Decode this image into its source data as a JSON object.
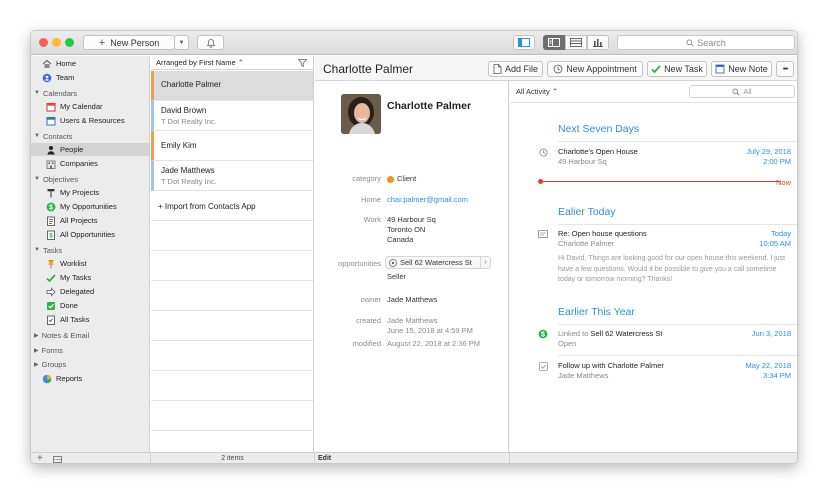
{
  "toolbar": {
    "new_person": "New Person",
    "search_placeholder": "Search"
  },
  "sidebar": {
    "home": "Home",
    "team": "Team",
    "calendars": {
      "label": "Calendars",
      "items": [
        "My Calendar",
        "Users & Resources"
      ]
    },
    "contacts": {
      "label": "Contacts",
      "items": [
        "People",
        "Companies"
      ]
    },
    "objectives": {
      "label": "Objectives",
      "items": [
        "My Projects",
        "My Opportunities",
        "All Projects",
        "All Opportunities"
      ]
    },
    "tasks": {
      "label": "Tasks",
      "items": [
        "Worklist",
        "My Tasks",
        "Delegated",
        "Done",
        "All Tasks"
      ]
    },
    "notes": "Notes & Email",
    "forms": "Forms",
    "groups": "Groups",
    "reports": "Reports"
  },
  "list": {
    "arranged_by": "Arranged by First Name ⌃",
    "rows": [
      {
        "name": "Charlotte Palmer",
        "sub": "",
        "accent": "#f0a04a"
      },
      {
        "name": "David Brown",
        "sub": "T Dot Realty Inc.",
        "accent": "#9fc6e8"
      },
      {
        "name": "Emily Kim",
        "sub": "",
        "accent": "#f0a04a"
      },
      {
        "name": "Jade Matthews",
        "sub": "T Dot Realty Inc.",
        "accent": "#9fc6e8"
      }
    ],
    "import": "+ Import from Contacts App",
    "count": "2 items"
  },
  "detail": {
    "header_name": "Charlotte Palmer",
    "name": "Charlotte Palmer",
    "category_label": "category",
    "category": "Client",
    "home_label": "Home",
    "home_email": "char.palmer@gmail.com",
    "work_label": "Work",
    "work_address": [
      "49 Harbour Sq",
      "Toronto ON",
      "Canada"
    ],
    "opportunities_label": "opportunities",
    "opportunity": "Sell 62 Watercress St",
    "opportunity_role": "Seller",
    "owner_label": "owner",
    "owner": "Jade Matthews",
    "created_label": "created",
    "created_by": "Jade Matthews",
    "created_at": "June 15, 2018 at 4:59 PM",
    "modified_label": "modified",
    "modified_at": "August 22, 2018 at 2:36 PM",
    "edit": "Edit"
  },
  "actions": {
    "add_file": "Add File",
    "new_appointment": "New Appointment",
    "new_task": "New Task",
    "new_note": "New Note",
    "more": "•••"
  },
  "activity": {
    "filter": "All Activity ⌃",
    "search_placeholder": "All",
    "sections": [
      {
        "title": "Next Seven Days"
      },
      {
        "title": "Ealier Today"
      },
      {
        "title": "Earlier This Year"
      }
    ],
    "items": [
      {
        "title": "Charlotte's Open House",
        "sub": "49 Harbour Sq",
        "date": "July 29, 2018",
        "time": "2:00 PM"
      },
      {
        "title": "Re: Open house questions",
        "sub": "Charlotte Palmer",
        "date": "Today",
        "time": "10:05 AM",
        "body": "Hi David, Things are looking good for our open house this weekend. I just have a few questions. Would it be possible to give you a call sometime today or tomorrow morning? Thanks!"
      },
      {
        "title_prefix": "Linked to",
        "title": "Sell 62 Watercress St",
        "sub": "Open",
        "date": "Jun 3, 2018",
        "time": ""
      },
      {
        "title": "Follow up with Charlotte Palmer",
        "sub": "Jade Matthews",
        "date": "May 22, 2018",
        "time": "3:34 PM"
      }
    ],
    "now": "Now"
  },
  "colors": {
    "accent": "#2f8fd8",
    "now_red": "#e8392f",
    "client_orange": "#f0901e",
    "selection": "#dcdcdc"
  }
}
